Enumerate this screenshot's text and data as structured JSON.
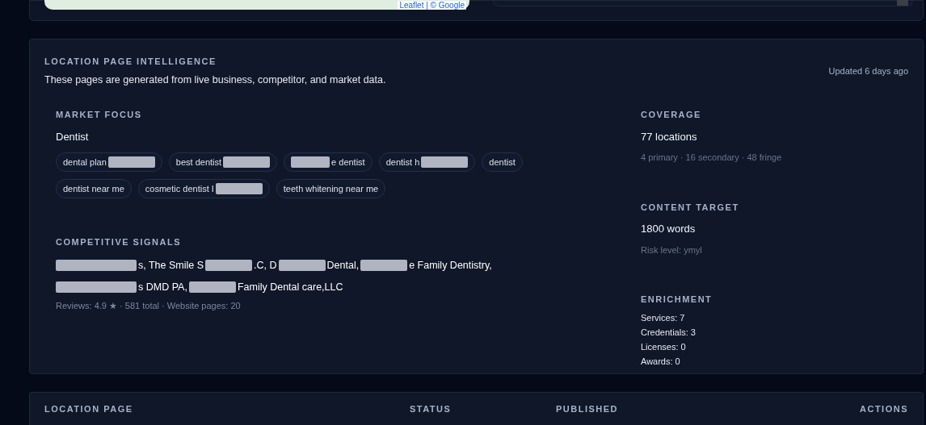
{
  "map_attribution": "Leaflet | © Google",
  "intelligence": {
    "title": "LOCATION PAGE INTELLIGENCE",
    "subtitle": "These pages are generated from live business, competitor, and market data.",
    "updated": "Updated 6 days ago",
    "market_focus": {
      "label": "MARKET FOCUS",
      "value": "Dentist",
      "keywords": [
        {
          "text": "dental plan",
          "redacted_after": true
        },
        {
          "text": "best dentist",
          "redacted_after": true
        },
        {
          "text": "e dentist",
          "redacted_before": true
        },
        {
          "text": "dentist h",
          "redacted_after": true
        },
        {
          "text": "dentist"
        },
        {
          "text": "dentist near me"
        },
        {
          "text": "cosmetic dentist I",
          "redacted_after": true
        },
        {
          "text": "teeth whitening near me"
        }
      ]
    },
    "competitive_signals": {
      "label": "COMPETITIVE SIGNALS",
      "fragments": [
        {
          "text": "s, The Smile S",
          "redacted_before": true,
          "redacted_after": true
        },
        {
          "text": ".C, D",
          "redacted_after": true
        },
        {
          "text": "Dental,",
          "redacted_after": true
        },
        {
          "text": "e Family Dentistry,",
          "line_break_after": true
        },
        {
          "text": "s DMD PA,",
          "redacted_before": true,
          "redacted_after": true
        },
        {
          "text": "Family Dental care,LLC"
        }
      ],
      "meta": "Reviews: 4.9 ★ · 581 total · Website pages: 20"
    },
    "coverage": {
      "label": "COVERAGE",
      "value": "77 locations",
      "detail": "4 primary · 16 secondary · 48 fringe"
    },
    "content_target": {
      "label": "CONTENT TARGET",
      "value": "1800 words",
      "detail": "Risk level: ymyl"
    },
    "enrichment": {
      "label": "ENRICHMENT",
      "items": [
        "Services: 7",
        "Credentials: 3",
        "Licenses: 0",
        "Awards: 0"
      ]
    }
  },
  "table": {
    "columns": [
      "LOCATION PAGE",
      "STATUS",
      "PUBLISHED",
      "ACTIONS"
    ]
  }
}
